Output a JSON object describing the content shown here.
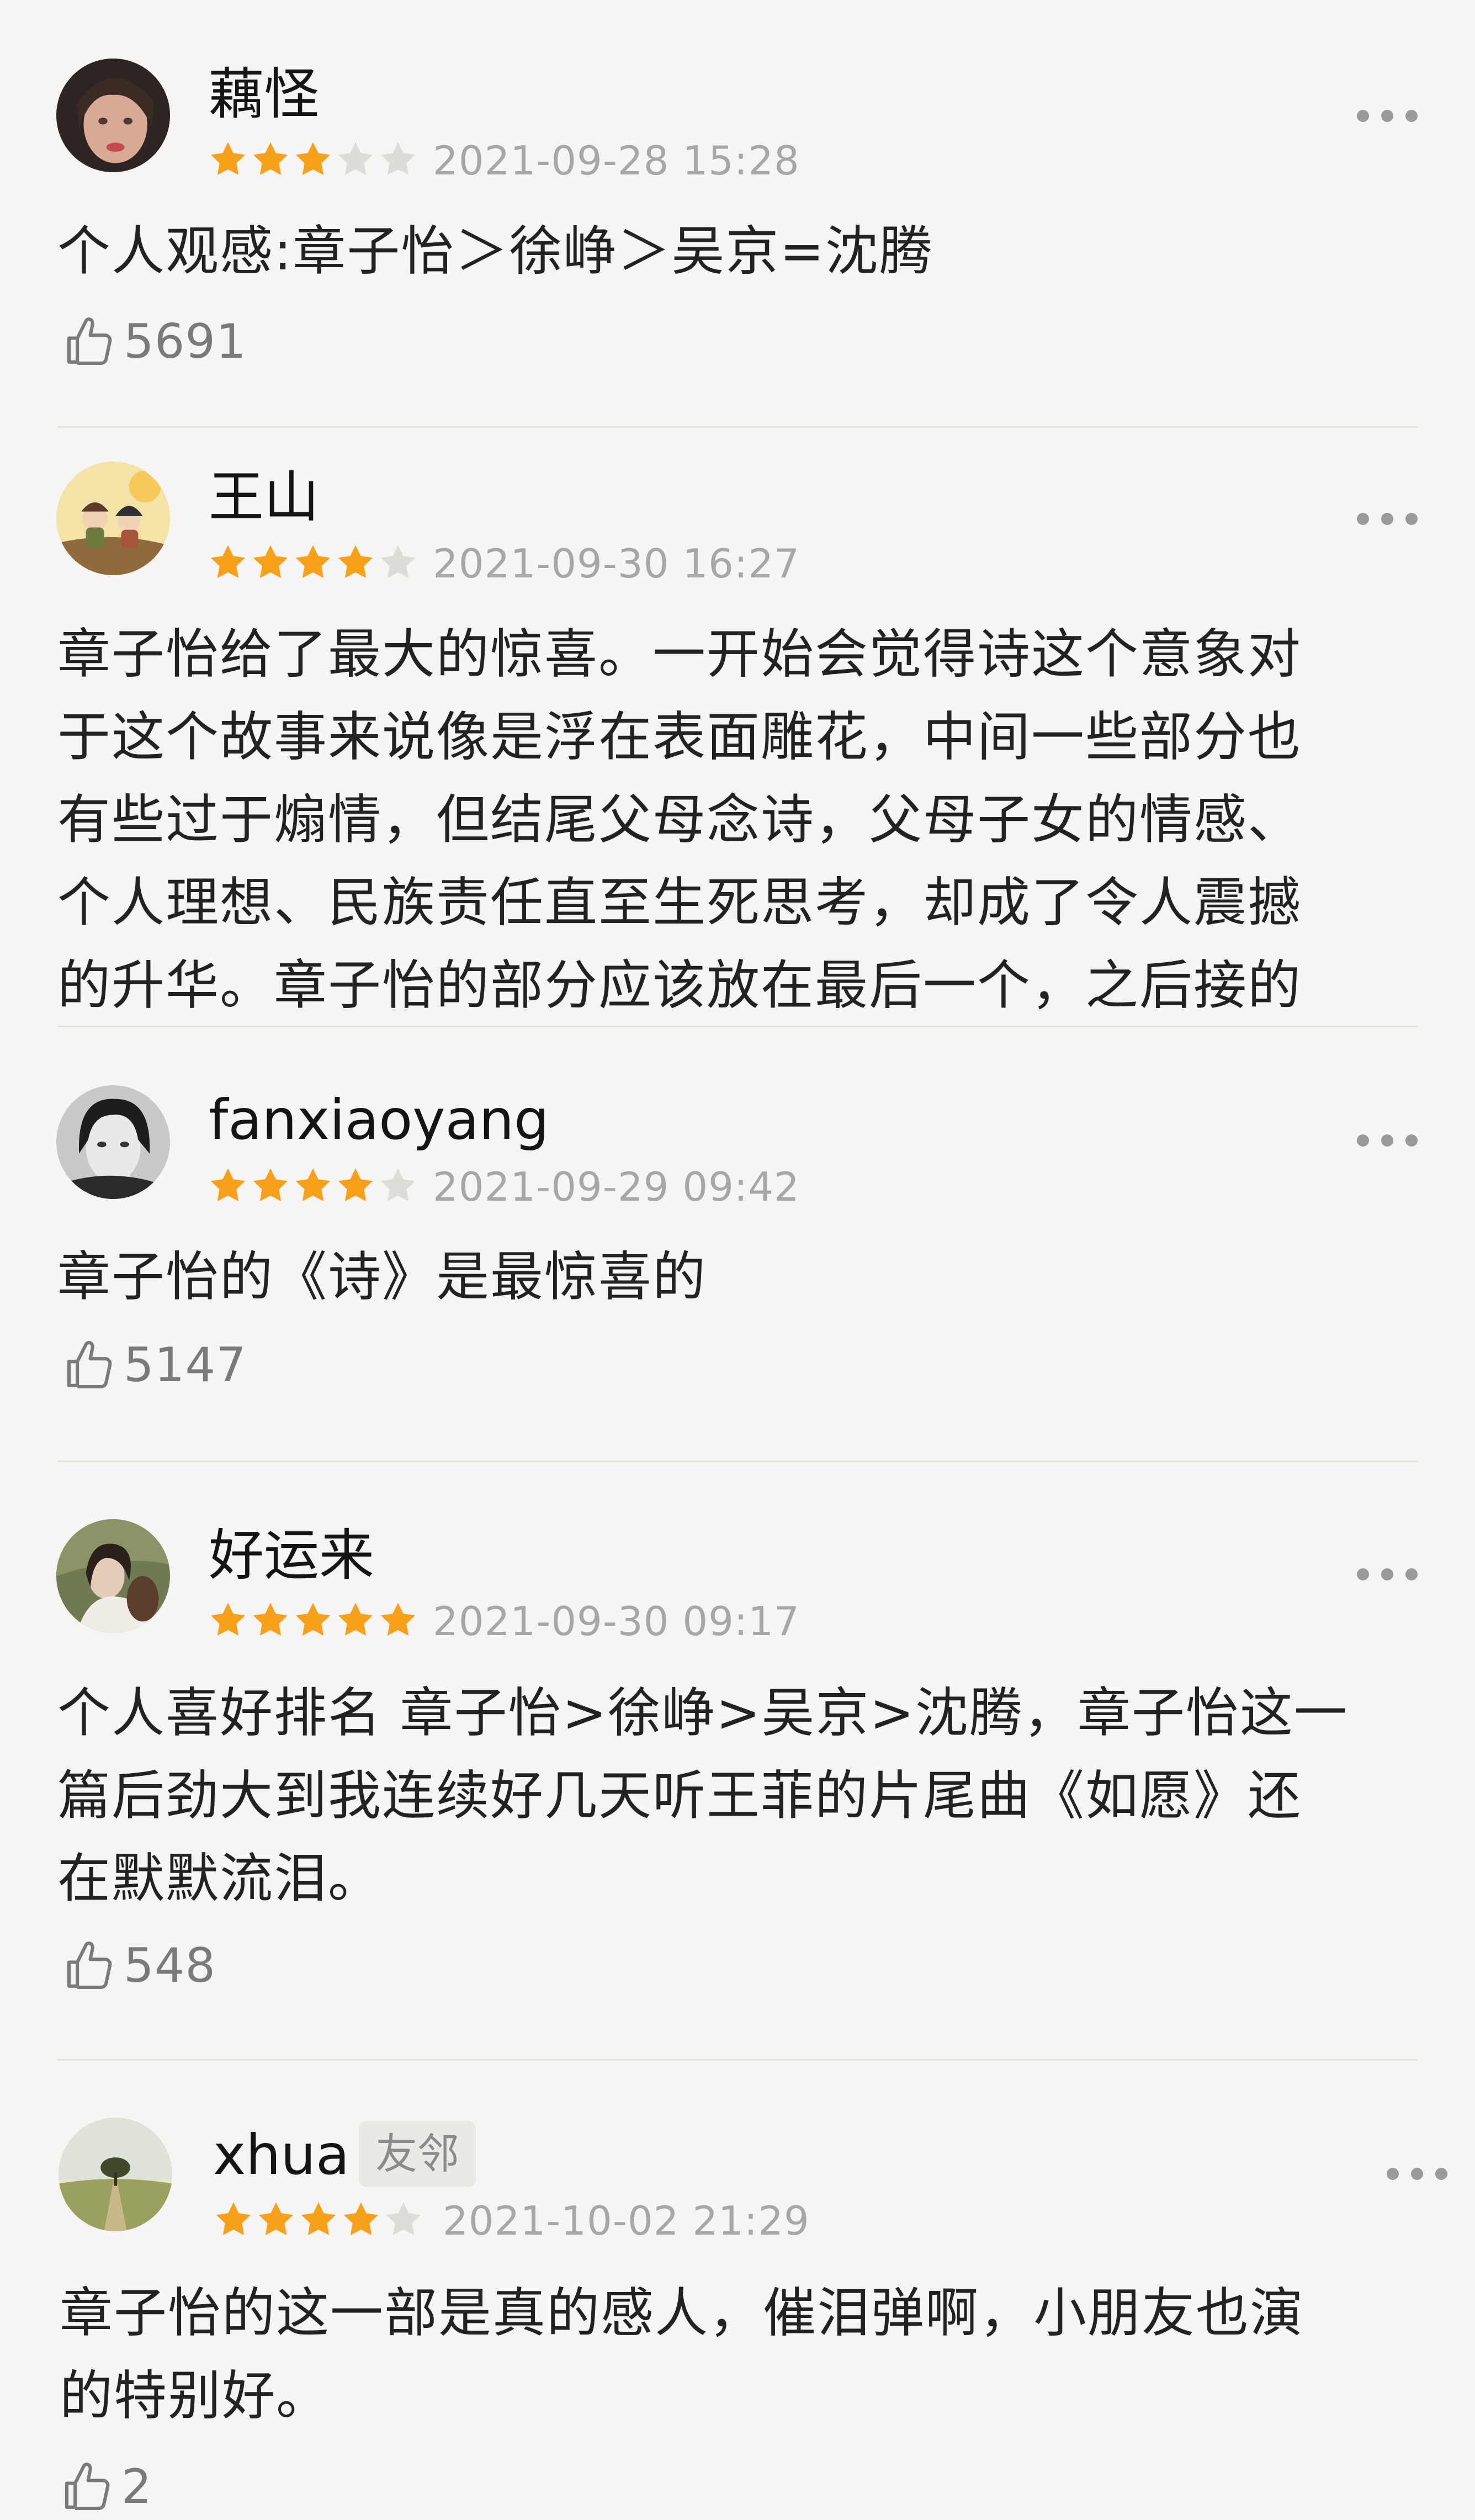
{
  "colors": {
    "background": "#f6f5f3",
    "star_filled": "#f9a01b",
    "star_empty": "#dedcd8",
    "meta_text": "#a7a7a7",
    "divider": "#e3e1de"
  },
  "icons": {
    "more": "more-dots-icon",
    "like": "thumbs-up-icon",
    "star": "star-icon"
  },
  "reviews": [
    {
      "username": "藕怪",
      "rating": 3,
      "rating_max": 5,
      "timestamp": "2021-09-28 15:28",
      "content": "个人观感:章子怡＞徐峥＞吴京=沈腾",
      "likes": "5691"
    },
    {
      "username": "王山",
      "rating": 4,
      "rating_max": 5,
      "timestamp": "2021-09-30 16:27",
      "content_lines": [
        "章子怡给了最大的惊喜。一开始会觉得诗这个意象对",
        "于这个故事来说像是浮在表面雕花，中间一些部分也",
        "有些过于煽情，但结尾父母念诗，父母子女的情感、",
        "个人理想、民族责任直至生死思考，却成了令人震撼",
        "的升华。章子怡的部分应该放在最后一个，之后接的"
      ]
    },
    {
      "username": "fanxiaoyang",
      "rating": 4,
      "rating_max": 5,
      "timestamp": "2021-09-29 09:42",
      "content": "章子怡的《诗》是最惊喜的",
      "likes": "5147"
    },
    {
      "username": "好运来",
      "rating": 5,
      "rating_max": 5,
      "timestamp": "2021-09-30 09:17",
      "content_lines": [
        "个人喜好排名 章子怡>徐峥>吴京>沈腾，章子怡这一",
        "篇后劲大到我连续好几天听王菲的片尾曲《如愿》还",
        "在默默流泪。"
      ],
      "likes": "548"
    },
    {
      "username": "xhua",
      "badge": "友邻",
      "rating": 4,
      "rating_max": 5,
      "timestamp": "2021-10-02 21:29",
      "content_lines": [
        "章子怡的这一部是真的感人，催泪弹啊，小朋友也演",
        "的特别好。"
      ],
      "likes": "2"
    }
  ]
}
